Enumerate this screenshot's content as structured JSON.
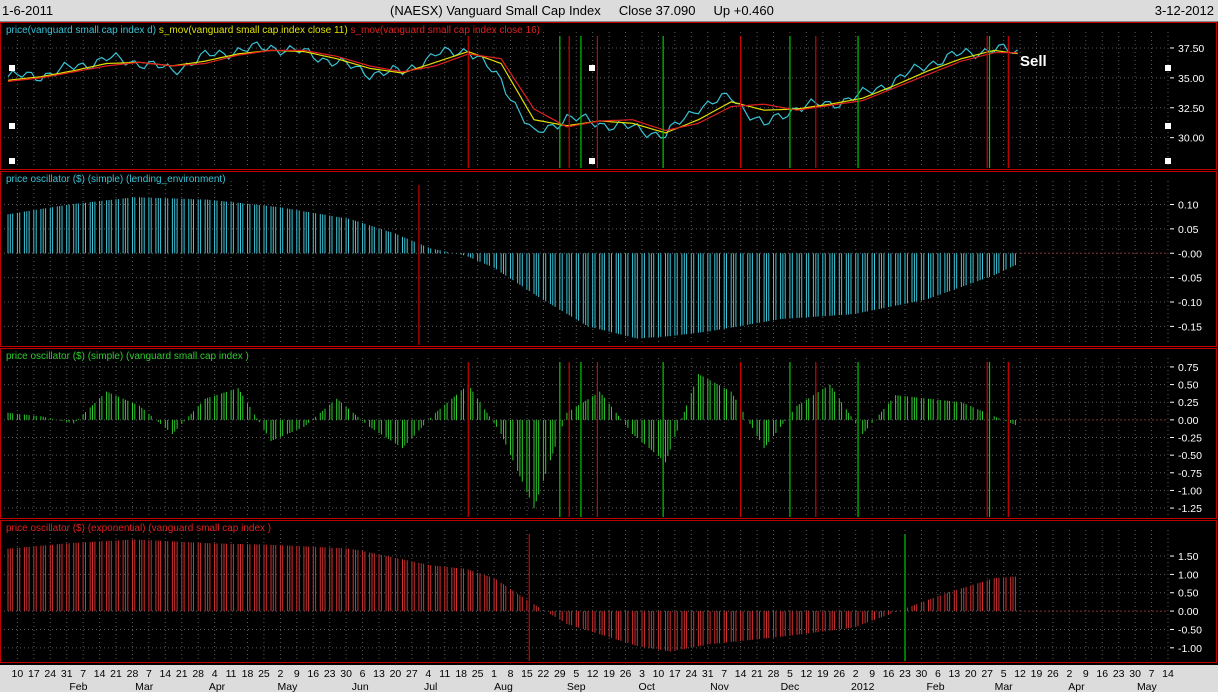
{
  "header": {
    "start_date": "1-6-2011",
    "symbol_title": "(NAESX)  Vanguard Small Cap Index",
    "close_label": "Close 37.090",
    "change_label": "Up +0.460",
    "end_date": "3-12-2012"
  },
  "colors": {
    "background": "#000000",
    "grid": "#5a5a5a",
    "pane_border": "#c00000",
    "price_line": "#36c3d6",
    "sma11": "#e0e000",
    "sma16": "#e02020",
    "buy_line": "#00c800",
    "sell_line": "#d00000",
    "hist_cyan": "#3cc6d8",
    "hist_green": "#2ecc2e",
    "hist_red": "#d03030",
    "axis_text": "#ffffff"
  },
  "annotation": {
    "text": "Sell"
  },
  "panes": [
    {
      "title_parts": [
        {
          "text": "price(vanguard small cap index  d)",
          "color": "#36c3d6"
        },
        {
          "text": "s_mov(vanguard small cap index  close 11)",
          "color": "#e0e000"
        },
        {
          "text": "s_mov(vanguard small cap index  close 16)",
          "color": "#e02020"
        }
      ]
    },
    {
      "title_parts": [
        {
          "text": "price oscillator ($) (simple) (lending_environment)",
          "color": "#36c3d6"
        }
      ]
    },
    {
      "title_parts": [
        {
          "text": "price oscillator ($) (simple) (vanguard small cap index )",
          "color": "#2ecc2e"
        }
      ]
    },
    {
      "title_parts": [
        {
          "text": "price oscillator ($) (exponential) (vanguard small cap index )",
          "color": "#e02020"
        }
      ]
    }
  ],
  "axes": {
    "x_day_ticks": [
      "10",
      "17",
      "24",
      "31",
      "7",
      "14",
      "21",
      "28",
      "7",
      "14",
      "21",
      "28",
      "4",
      "11",
      "18",
      "25",
      "2",
      "9",
      "16",
      "23",
      "30",
      "6",
      "13",
      "20",
      "27",
      "4",
      "11",
      "18",
      "25",
      "1",
      "8",
      "15",
      "22",
      "29",
      "5",
      "12",
      "19",
      "26",
      "3",
      "10",
      "17",
      "24",
      "31",
      "7",
      "14",
      "21",
      "28",
      "5",
      "12",
      "19",
      "26",
      "2",
      "9",
      "16",
      "23",
      "30",
      "6",
      "13",
      "20",
      "27",
      "5",
      "12",
      "19",
      "26",
      "2",
      "9",
      "16",
      "23",
      "30",
      "7",
      "14"
    ],
    "x_month_labels": [
      "Feb",
      "Mar",
      "Apr",
      "May",
      "Jun",
      "Jul",
      "Aug",
      "Sep",
      "Oct",
      "Nov",
      "Dec",
      "2012",
      "Feb",
      "Mar",
      "Apr",
      "May"
    ]
  },
  "chart_data": [
    {
      "type": "line",
      "pane": "price",
      "x_range": [
        "2011-01-06",
        "2012-05-14"
      ],
      "ylim": [
        27.8,
        38.5
      ],
      "y_ticks": [
        "37.50",
        "35.00",
        "32.50",
        "30.00"
      ],
      "x": [
        "2011-01-06",
        "2011-01-20",
        "2011-02-03",
        "2011-02-17",
        "2011-03-03",
        "2011-03-17",
        "2011-03-31",
        "2011-04-14",
        "2011-04-28",
        "2011-05-12",
        "2011-05-26",
        "2011-06-09",
        "2011-06-23",
        "2011-07-07",
        "2011-07-21",
        "2011-08-04",
        "2011-08-18",
        "2011-09-01",
        "2011-09-15",
        "2011-09-29",
        "2011-10-13",
        "2011-10-27",
        "2011-11-10",
        "2011-11-24",
        "2011-12-08",
        "2011-12-22",
        "2012-01-05",
        "2012-01-19",
        "2012-02-02",
        "2012-02-16",
        "2012-03-01",
        "2012-03-12"
      ],
      "series": [
        {
          "name": "price(vanguard small cap index  d)",
          "values": [
            35.1,
            35.2,
            35.9,
            36.6,
            36.3,
            35.6,
            36.8,
            37.3,
            37.6,
            37.1,
            36.3,
            35.4,
            35.5,
            36.9,
            37.4,
            34.8,
            30.2,
            31.7,
            31.2,
            30.8,
            30.2,
            32.6,
            33.4,
            31.0,
            32.6,
            32.8,
            33.6,
            34.8,
            36.2,
            37.0,
            37.4,
            37.1
          ]
        },
        {
          "name": "s_mov(vanguard small cap index  close 11)",
          "values": [
            34.8,
            35.1,
            35.6,
            36.2,
            36.3,
            36.0,
            36.4,
            37.0,
            37.3,
            37.2,
            36.6,
            35.8,
            35.4,
            36.3,
            37.2,
            36.2,
            31.5,
            31.0,
            31.4,
            31.2,
            30.4,
            31.5,
            33.0,
            32.3,
            32.4,
            32.8,
            33.3,
            34.4,
            35.6,
            36.6,
            37.3,
            37.0
          ]
        },
        {
          "name": "s_mov(vanguard small cap index  close 16)",
          "values": [
            34.7,
            35.0,
            35.5,
            36.0,
            36.3,
            36.0,
            36.2,
            36.9,
            37.3,
            37.3,
            36.8,
            36.0,
            35.5,
            36.0,
            37.0,
            36.6,
            32.4,
            30.9,
            31.4,
            31.5,
            30.6,
            31.2,
            32.6,
            32.8,
            32.3,
            32.7,
            33.1,
            34.2,
            35.3,
            36.4,
            37.1,
            37.1
          ]
        }
      ],
      "signals": [
        {
          "date": "2011-07-21",
          "kind": "sell"
        },
        {
          "date": "2011-08-29",
          "kind": "buy"
        },
        {
          "date": "2011-09-02",
          "kind": "sell"
        },
        {
          "date": "2011-09-07",
          "kind": "buy"
        },
        {
          "date": "2011-09-14",
          "kind": "sell"
        },
        {
          "date": "2011-10-12",
          "kind": "buy"
        },
        {
          "date": "2011-11-14",
          "kind": "sell"
        },
        {
          "date": "2011-12-05",
          "kind": "buy"
        },
        {
          "date": "2011-12-16",
          "kind": "sell"
        },
        {
          "date": "2012-01-03",
          "kind": "buy"
        },
        {
          "date": "2012-02-27",
          "kind": "sell"
        },
        {
          "date": "2012-02-28",
          "kind": "buy"
        },
        {
          "date": "2012-03-07",
          "kind": "sell"
        }
      ]
    },
    {
      "type": "bar",
      "pane": "osc_lending",
      "ylim": [
        -0.18,
        0.14
      ],
      "y_ticks": [
        "0.10",
        "0.05",
        "-0.00",
        "-0.05",
        "-0.10",
        "-0.15"
      ],
      "x": [
        "2011-01-06",
        "2011-02-01",
        "2011-03-01",
        "2011-04-01",
        "2011-05-01",
        "2011-06-01",
        "2011-06-20",
        "2011-07-05",
        "2011-07-20",
        "2011-08-01",
        "2011-08-20",
        "2011-09-10",
        "2011-10-01",
        "2011-10-15",
        "2011-11-01",
        "2011-12-01",
        "2012-01-01",
        "2012-02-01",
        "2012-03-01",
        "2012-03-12"
      ],
      "values": [
        0.08,
        0.1,
        0.115,
        0.11,
        0.095,
        0.07,
        0.04,
        0.01,
        -0.005,
        -0.03,
        -0.09,
        -0.15,
        -0.175,
        -0.17,
        -0.16,
        -0.135,
        -0.125,
        -0.095,
        -0.045,
        -0.02
      ],
      "signals": [
        {
          "date": "2011-06-30",
          "kind": "sell"
        }
      ]
    },
    {
      "type": "bar",
      "pane": "osc_simple",
      "ylim": [
        -1.32,
        0.82
      ],
      "y_ticks": [
        "0.75",
        "0.50",
        "0.25",
        "0.00",
        "-0.25",
        "-0.50",
        "-0.75",
        "-1.00",
        "-1.25"
      ],
      "x": [
        "2011-01-06",
        "2011-01-20",
        "2011-02-03",
        "2011-02-17",
        "2011-03-03",
        "2011-03-17",
        "2011-03-31",
        "2011-04-14",
        "2011-04-28",
        "2011-05-12",
        "2011-05-26",
        "2011-06-09",
        "2011-06-23",
        "2011-07-07",
        "2011-07-21",
        "2011-08-04",
        "2011-08-18",
        "2011-09-01",
        "2011-09-15",
        "2011-09-29",
        "2011-10-13",
        "2011-10-27",
        "2011-11-10",
        "2011-11-24",
        "2011-12-08",
        "2011-12-22",
        "2012-01-05",
        "2012-01-19",
        "2012-02-02",
        "2012-02-16",
        "2012-03-01",
        "2012-03-12"
      ],
      "values": [
        0.1,
        0.05,
        -0.05,
        0.4,
        0.2,
        -0.2,
        0.3,
        0.45,
        -0.3,
        -0.1,
        0.3,
        -0.1,
        -0.4,
        0.1,
        0.5,
        -0.2,
        -1.25,
        0.1,
        0.4,
        -0.2,
        -0.6,
        0.65,
        0.4,
        -0.4,
        0.2,
        0.5,
        -0.2,
        0.35,
        0.3,
        0.25,
        0.05,
        -0.1
      ],
      "signals": [
        {
          "date": "2011-07-21",
          "kind": "sell"
        },
        {
          "date": "2011-08-29",
          "kind": "buy"
        },
        {
          "date": "2011-09-02",
          "kind": "sell"
        },
        {
          "date": "2011-09-07",
          "kind": "buy"
        },
        {
          "date": "2011-09-14",
          "kind": "sell"
        },
        {
          "date": "2011-10-12",
          "kind": "buy"
        },
        {
          "date": "2011-11-14",
          "kind": "sell"
        },
        {
          "date": "2011-12-05",
          "kind": "buy"
        },
        {
          "date": "2011-12-16",
          "kind": "sell"
        },
        {
          "date": "2012-01-03",
          "kind": "buy"
        },
        {
          "date": "2012-02-27",
          "kind": "sell"
        },
        {
          "date": "2012-02-28",
          "kind": "buy"
        },
        {
          "date": "2012-03-07",
          "kind": "sell"
        }
      ]
    },
    {
      "type": "bar",
      "pane": "osc_exponential",
      "ylim": [
        -1.25,
        2.1
      ],
      "y_ticks": [
        "1.50",
        "1.00",
        "0.50",
        "0.00",
        "-0.50",
        "-1.00"
      ],
      "x": [
        "2011-01-06",
        "2011-02-01",
        "2011-03-01",
        "2011-04-01",
        "2011-05-01",
        "2011-06-01",
        "2011-06-20",
        "2011-07-05",
        "2011-07-20",
        "2011-08-01",
        "2011-08-15",
        "2011-09-01",
        "2011-10-01",
        "2011-10-15",
        "2011-11-01",
        "2011-12-01",
        "2012-01-01",
        "2012-01-20",
        "2012-02-10",
        "2012-03-01",
        "2012-03-12"
      ],
      "values": [
        1.7,
        1.85,
        1.95,
        1.85,
        1.8,
        1.7,
        1.45,
        1.25,
        1.15,
        0.9,
        0.3,
        -0.35,
        -0.95,
        -1.1,
        -0.9,
        -0.7,
        -0.45,
        0.0,
        0.5,
        0.9,
        0.95
      ],
      "signals": [
        {
          "date": "2011-08-16",
          "kind": "sell"
        },
        {
          "date": "2012-01-23",
          "kind": "buy"
        }
      ]
    }
  ]
}
